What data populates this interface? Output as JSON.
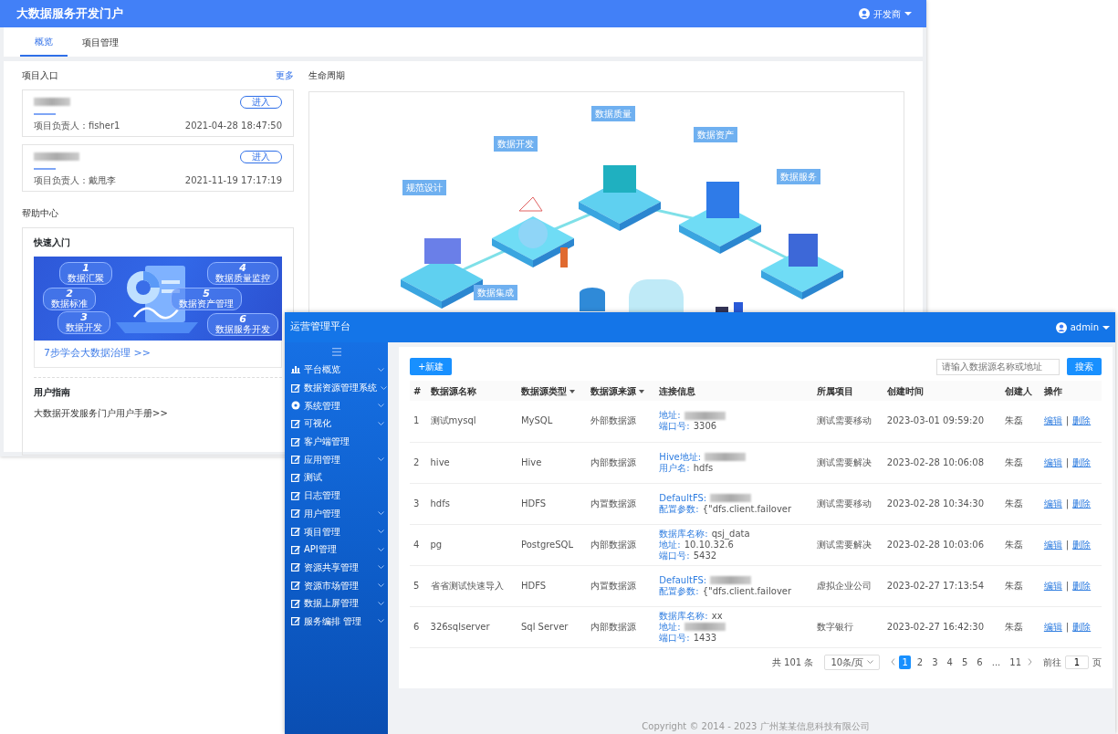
{
  "portal": {
    "title": "大数据服务开发门户",
    "user": "开发商",
    "tabs": [
      {
        "label": "概览",
        "selected": true
      },
      {
        "label": "项目管理",
        "selected": false
      }
    ],
    "projects_title": "项目入口",
    "more_link": "更多",
    "projects": [
      {
        "owner": "项目负责人：fisher1",
        "time": "2021-04-28 18:47:50",
        "button": "进入"
      },
      {
        "owner": "项目负责人：戴甩李",
        "time": "2021-11-19 17:17:19",
        "button": "进入"
      }
    ],
    "help_title": "帮助中心",
    "quick_title": "快速入门",
    "steps": [
      {
        "number": "1",
        "label": "数据汇聚"
      },
      {
        "number": "2",
        "label": "数据标准"
      },
      {
        "number": "3",
        "label": "数据开发"
      },
      {
        "number": "4",
        "label": "数据质量监控"
      },
      {
        "number": "5",
        "label": "数据资产管理"
      },
      {
        "number": "6",
        "label": "数据服务开发"
      }
    ],
    "steps_link": "7步学会大数据治理 >>",
    "guide_title": "用户指南",
    "guide_link": "大数据开发服务门户用户手册>>",
    "lifecycle_title": "生命周期",
    "stages": [
      "规范设计",
      "数据开发",
      "数据质量",
      "数据资产",
      "数据服务",
      "数据集成"
    ]
  },
  "admin": {
    "title": "运营管理平台",
    "user": "admin",
    "menu": [
      {
        "label": "平台概览",
        "kind": "chart",
        "expandable": true
      },
      {
        "label": "数据资源管理系统",
        "kind": "edit",
        "expandable": true
      },
      {
        "label": "系统管理",
        "kind": "gear",
        "expandable": true
      },
      {
        "label": "可视化",
        "kind": "edit",
        "expandable": true
      },
      {
        "label": "客户端管理",
        "kind": "edit",
        "expandable": false
      },
      {
        "label": "应用管理",
        "kind": "edit",
        "expandable": true
      },
      {
        "label": "测试",
        "kind": "edit",
        "expandable": false
      },
      {
        "label": "日志管理",
        "kind": "edit",
        "expandable": false
      },
      {
        "label": "用户管理",
        "kind": "edit",
        "expandable": true
      },
      {
        "label": "项目管理",
        "kind": "edit",
        "expandable": true
      },
      {
        "label": "API管理",
        "kind": "edit",
        "expandable": true
      },
      {
        "label": "资源共享管理",
        "kind": "edit",
        "expandable": true
      },
      {
        "label": "资源市场管理",
        "kind": "edit",
        "expandable": true
      },
      {
        "label": "数据上屏管理",
        "kind": "edit",
        "expandable": true
      },
      {
        "label": "服务编排 管理",
        "kind": "edit",
        "expandable": true
      }
    ],
    "new_button": "+新建",
    "search": {
      "placeholder": "请输入数据源名称或地址"
    },
    "search_button": "搜索",
    "columns": [
      {
        "label": "#",
        "sortable": false
      },
      {
        "label": "数据源名称",
        "sortable": false
      },
      {
        "label": "数据源类型",
        "sortable": true
      },
      {
        "label": "数据源来源",
        "sortable": true
      },
      {
        "label": "连接信息",
        "sortable": false
      },
      {
        "label": "所属项目",
        "sortable": false
      },
      {
        "label": "创建时间",
        "sortable": false
      },
      {
        "label": "创建人",
        "sortable": false
      },
      {
        "label": "操作",
        "sortable": false
      }
    ],
    "rows": [
      {
        "index": "1",
        "name": "测试mysql",
        "type": "MySQL",
        "source": "外部数据源",
        "connection": [
          {
            "label": "地址:",
            "redacted": true
          },
          {
            "label": "端口号:",
            "value": "3306",
            "redacted": false
          }
        ],
        "project": "测试需要移动",
        "created": "2023-03-01 09:59:20",
        "creator": "朱磊",
        "edit": "编辑",
        "separator": "|",
        "delete": "删除"
      },
      {
        "index": "2",
        "name": "hive",
        "type": "Hive",
        "source": "内部数据源",
        "connection": [
          {
            "label": "Hive地址:",
            "redacted": true
          },
          {
            "label": "用户名:",
            "value": "hdfs",
            "redacted": false
          }
        ],
        "project": "测试需要解决",
        "created": "2023-02-28 10:06:08",
        "creator": "朱磊",
        "edit": "编辑",
        "separator": "|",
        "delete": "删除"
      },
      {
        "index": "3",
        "name": "hdfs",
        "type": "HDFS",
        "source": "内置数据源",
        "connection": [
          {
            "label": "DefaultFS:",
            "redacted": true
          },
          {
            "label": "配置参数:",
            "value": "{\"dfs.client.failover",
            "redacted": false
          }
        ],
        "project": "测试需要移动",
        "created": "2023-02-28 10:34:30",
        "creator": "朱磊",
        "edit": "编辑",
        "separator": "|",
        "delete": "删除"
      },
      {
        "index": "4",
        "name": "pg",
        "type": "PostgreSQL",
        "source": "内部数据源",
        "connection": [
          {
            "label": "数据库名称:",
            "value": "qsj_data",
            "redacted": false
          },
          {
            "label": "地址:",
            "value": "10.10.32.6",
            "redacted": false
          },
          {
            "label": "端口号:",
            "value": "5432",
            "redacted": false
          }
        ],
        "project": "测试需要解决",
        "created": "2023-02-28 10:03:06",
        "creator": "朱磊",
        "edit": "编辑",
        "separator": "|",
        "delete": "删除"
      },
      {
        "index": "5",
        "name": "省省测试快速导入",
        "type": "HDFS",
        "source": "内置数据源",
        "connection": [
          {
            "label": "DefaultFS:",
            "redacted": true
          },
          {
            "label": "配置参数:",
            "value": "{\"dfs.client.failover",
            "redacted": false
          }
        ],
        "project": "虚拟企业公司",
        "created": "2023-02-27 17:13:54",
        "creator": "朱磊",
        "edit": "编辑",
        "separator": "|",
        "delete": "删除"
      },
      {
        "index": "6",
        "name": "326sqlserver",
        "type": "Sql Server",
        "source": "内部数据源",
        "connection": [
          {
            "label": "数据库名称:",
            "value": "xx",
            "redacted": false
          },
          {
            "label": "地址:",
            "redacted": true
          },
          {
            "label": "端口号:",
            "value": "1433",
            "redacted": false
          }
        ],
        "project": "数字银行",
        "created": "2023-02-27 16:42:30",
        "creator": "朱磊",
        "edit": "编辑",
        "separator": "|",
        "delete": "删除"
      }
    ],
    "pagination": {
      "total": "共 101 条",
      "page_size": "10条/页",
      "pages": [
        {
          "label": "1",
          "selected": true
        },
        {
          "label": "2",
          "selected": false
        },
        {
          "label": "3",
          "selected": false
        },
        {
          "label": "4",
          "selected": false
        },
        {
          "label": "5",
          "selected": false
        },
        {
          "label": "6",
          "selected": false
        },
        {
          "label": "...",
          "selected": false
        },
        {
          "label": "11",
          "selected": false
        }
      ],
      "goto_label": "前往",
      "goto_value": "1",
      "goto_unit": "页"
    },
    "footer": "Copyright © 2014 - 2023 广州某某信息科技有限公司"
  }
}
